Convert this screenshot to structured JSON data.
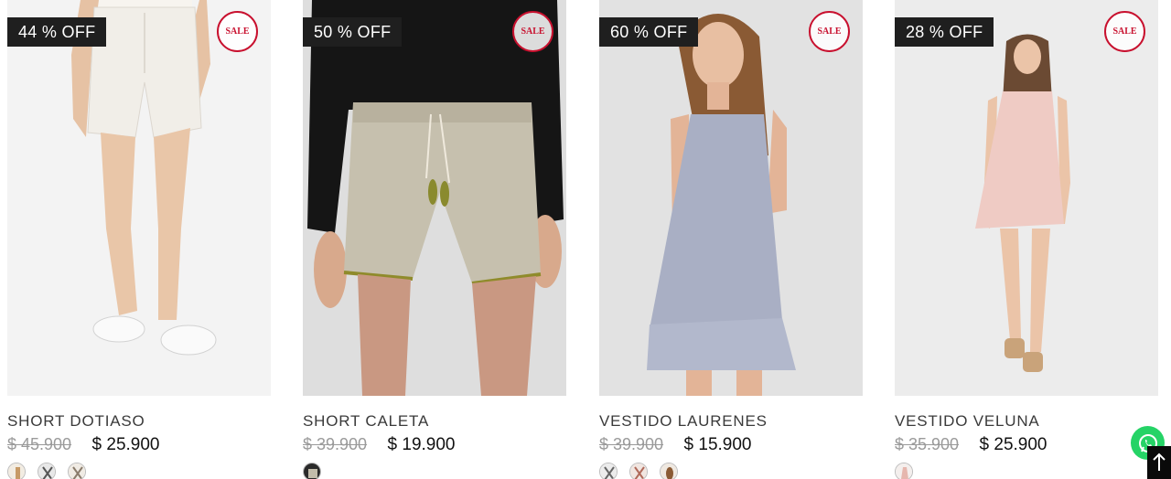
{
  "products": [
    {
      "name": "SHORT DOTIASO",
      "discount": "44 % OFF",
      "sale_badge": "SALE",
      "old_price": "$ 45.900",
      "new_price": "$ 25.900",
      "image": "white-shorts-model",
      "swatch_count": 3
    },
    {
      "name": "SHORT CALETA",
      "discount": "50 % OFF",
      "sale_badge": "SALE",
      "old_price": "$ 39.900",
      "new_price": "$ 19.900",
      "image": "beige-linen-shorts-model",
      "swatch_count": 1
    },
    {
      "name": "VESTIDO LAURENES",
      "discount": "60 % OFF",
      "sale_badge": "SALE",
      "old_price": "$ 39.900",
      "new_price": "$ 15.900",
      "image": "grey-slip-dress-model",
      "swatch_count": 3
    },
    {
      "name": "VESTIDO VELUNA",
      "discount": "28 % OFF",
      "sale_badge": "SALE",
      "old_price": "$ 35.900",
      "new_price": "$ 25.900",
      "image": "pink-mini-dress-model",
      "swatch_count": 1
    }
  ],
  "floating": {
    "whatsapp_icon": "whatsapp-icon",
    "scroll_top_icon": "arrow-up-icon"
  },
  "colors": {
    "sale_red": "#c8102e",
    "badge_dark": "#1f1f1f",
    "whatsapp_green": "#25d366"
  }
}
